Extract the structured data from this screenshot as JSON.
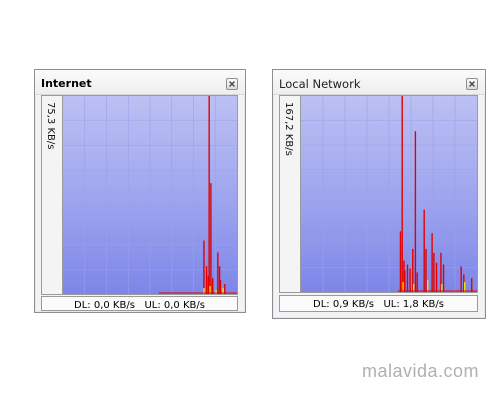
{
  "colors": {
    "graph_top": "#bcc0f3",
    "graph_bottom": "#7d86e8",
    "grid_line": "#9aa0ea",
    "download_line": "#e00000",
    "upload_line": "#f2e600"
  },
  "widgets": [
    {
      "title": "Internet",
      "scale_label": "75,3 KB/s",
      "status": "DL: 0,0 KB/s   UL: 0,0 KB/s",
      "close_icon": "close-icon",
      "download_spikes": [
        {
          "x": 0.84,
          "v": 1.0
        },
        {
          "x": 0.85,
          "v": 0.56
        },
        {
          "x": 0.81,
          "v": 0.27
        },
        {
          "x": 0.825,
          "v": 0.14
        },
        {
          "x": 0.835,
          "v": 0.09
        },
        {
          "x": 0.89,
          "v": 0.21
        },
        {
          "x": 0.9,
          "v": 0.14
        },
        {
          "x": 0.905,
          "v": 0.07
        },
        {
          "x": 0.86,
          "v": 0.08
        },
        {
          "x": 0.93,
          "v": 0.05
        }
      ],
      "upload_spikes": [
        {
          "x": 0.81,
          "v": 0.03
        },
        {
          "x": 0.845,
          "v": 0.04
        },
        {
          "x": 0.88,
          "v": 0.02
        },
        {
          "x": 0.92,
          "v": 0.03
        }
      ]
    },
    {
      "title": "Local Network",
      "scale_label": "167,2 KB/s",
      "status": "DL: 0,9 KB/s   UL: 1,8 KB/s",
      "close_icon": "close-icon",
      "download_spikes": [
        {
          "x": 0.575,
          "v": 1.0
        },
        {
          "x": 0.65,
          "v": 0.82
        },
        {
          "x": 0.565,
          "v": 0.31
        },
        {
          "x": 0.585,
          "v": 0.16
        },
        {
          "x": 0.59,
          "v": 0.11
        },
        {
          "x": 0.605,
          "v": 0.14
        },
        {
          "x": 0.62,
          "v": 0.12
        },
        {
          "x": 0.635,
          "v": 0.22
        },
        {
          "x": 0.66,
          "v": 0.1
        },
        {
          "x": 0.7,
          "v": 0.42
        },
        {
          "x": 0.71,
          "v": 0.22
        },
        {
          "x": 0.745,
          "v": 0.3
        },
        {
          "x": 0.755,
          "v": 0.2
        },
        {
          "x": 0.77,
          "v": 0.15
        },
        {
          "x": 0.795,
          "v": 0.2
        },
        {
          "x": 0.81,
          "v": 0.14
        },
        {
          "x": 0.91,
          "v": 0.13
        },
        {
          "x": 0.925,
          "v": 0.09
        },
        {
          "x": 0.97,
          "v": 0.07
        }
      ],
      "upload_spikes": [
        {
          "x": 0.58,
          "v": 0.05
        },
        {
          "x": 0.64,
          "v": 0.04
        },
        {
          "x": 0.72,
          "v": 0.06
        },
        {
          "x": 0.8,
          "v": 0.04
        },
        {
          "x": 0.93,
          "v": 0.05
        }
      ]
    }
  ],
  "watermark": "malavida.com"
}
